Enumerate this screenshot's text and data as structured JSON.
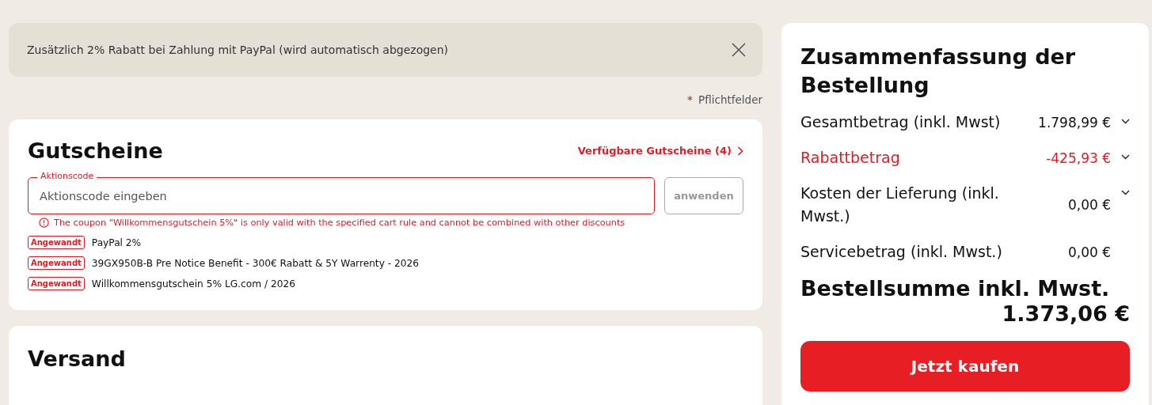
{
  "banner": {
    "text": "Zusätzlich 2% Rabatt bei Zahlung mit PayPal (wird automatisch abgezogen)"
  },
  "required_note": {
    "mark": "*",
    "text": "Pflichtfelder"
  },
  "vouchers": {
    "title": "Gutscheine",
    "available_link": "Verfügbare Gutscheine (4)",
    "field": {
      "label": "Aktionscode",
      "placeholder": "Aktionscode eingeben"
    },
    "apply_button": {
      "label": "anwenden",
      "disabled": true
    },
    "error": "The coupon \"Willkommensgutschein 5%\" is only valid with the specified cart rule and cannot be combined with other discounts",
    "applied": [
      {
        "badge": "Angewandt",
        "name": "PayPal 2%"
      },
      {
        "badge": "Angewandt",
        "name": "39GX950B-B Pre Notice Benefit - 300€ Rabatt & 5Y Warrenty - 2026"
      },
      {
        "badge": "Angewandt",
        "name": "Willkommensgutschein 5% LG.com / 2026"
      }
    ]
  },
  "shipping": {
    "title": "Versand"
  },
  "summary": {
    "title": "Zusammenfassung der Bestellung",
    "rows": [
      {
        "label": "Gesamtbetrag (inkl. Mwst)",
        "value": "1.798,99 €",
        "expandable": true,
        "discount": false
      },
      {
        "label": "Rabattbetrag",
        "value": "-425,93 €",
        "expandable": true,
        "discount": true
      },
      {
        "label": "Kosten der Lieferung (inkl. Mwst.)",
        "value": "0,00 €",
        "expandable": true,
        "discount": false
      },
      {
        "label": "Servicebetrag (inkl. Mwst.)",
        "value": "0,00 €",
        "expandable": false,
        "discount": false
      }
    ],
    "total_label": "Bestellsumme inkl. Mwst.",
    "total_value": "1.373,06 €",
    "buy_button": "Jetzt kaufen"
  }
}
